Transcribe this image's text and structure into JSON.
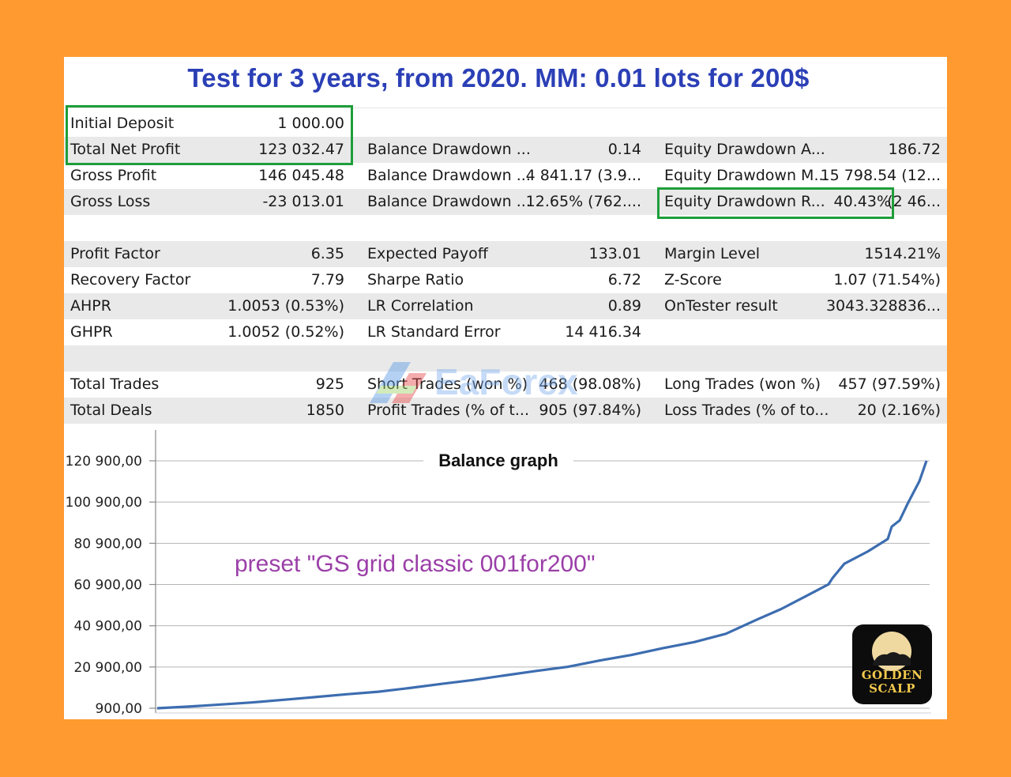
{
  "title": "Test for 3 years, from 2020. MM: 0.01 lots for 200$",
  "stats": {
    "row1": {
      "l1": "Initial Deposit",
      "v1": "1 000.00"
    },
    "row2": {
      "l1": "Total Net Profit",
      "v1": "123 032.47",
      "l2": "Balance Drawdown ...",
      "v2": "0.14",
      "l3": "Equity Drawdown A...",
      "v3": "186.72"
    },
    "row3": {
      "l1": "Gross Profit",
      "v1": "146 045.48",
      "l2": "Balance Drawdown ...",
      "v2": "4 841.17 (3.9...",
      "l3": "Equity Drawdown M...",
      "v3": "15 798.54 (12..."
    },
    "row4": {
      "l1": "Gross Loss",
      "v1": "-23 013.01",
      "l2": "Balance Drawdown ...",
      "v2": "12.65% (762....",
      "l3": "Equity Drawdown R...",
      "v3a": "40.43%",
      "v3b": "(2 46..."
    },
    "row6": {
      "l1": "Profit Factor",
      "v1": "6.35",
      "l2": "Expected Payoff",
      "v2": "133.01",
      "l3": "Margin Level",
      "v3": "1514.21%"
    },
    "row7": {
      "l1": "Recovery Factor",
      "v1": "7.79",
      "l2": "Sharpe Ratio",
      "v2": "6.72",
      "l3": "Z-Score",
      "v3": "1.07 (71.54%)"
    },
    "row8": {
      "l1": "AHPR",
      "v1": "1.0053 (0.53%)",
      "l2": "LR Correlation",
      "v2": "0.89",
      "l3": "OnTester result",
      "v3": "3043.328836..."
    },
    "row9": {
      "l1": "GHPR",
      "v1": "1.0052 (0.52%)",
      "l2": "LR Standard Error",
      "v2": "14 416.34"
    },
    "row11": {
      "l1": "Total Trades",
      "v1": "925",
      "l2": "Short Trades (won %)",
      "v2": "468 (98.08%)",
      "l3": "Long Trades (won %)",
      "v3": "457 (97.59%)"
    },
    "row12": {
      "l1": "Total Deals",
      "v1": "1850",
      "l2": "Profit Trades (% of t...",
      "v2": "905 (97.84%)",
      "l3": "Loss Trades (% of to...",
      "v3": "20 (2.16%)"
    }
  },
  "watermark": "EaForex",
  "chart_data": {
    "type": "line",
    "title": "Balance graph",
    "annotation": "preset \"GS grid classic 001for200\"",
    "ylim": [
      900,
      122400
    ],
    "y_ticks": [
      900,
      20900,
      40900,
      60900,
      80900,
      100900,
      120900
    ],
    "y_tick_labels": [
      "900,00",
      "20 900,00",
      "40 900,00",
      "60 900,00",
      "80 900,00",
      "100 900,00",
      "120 900,00"
    ],
    "line_color": "#3D6DB0",
    "grid": true,
    "series": [
      {
        "x": [
          0,
          40,
          80,
          120,
          160,
          200,
          240,
          280,
          320,
          360,
          400,
          440,
          480,
          520,
          560,
          600,
          640,
          680,
          720,
          760,
          790,
          820,
          850,
          855,
          870,
          900,
          925,
          930,
          940,
          950,
          965,
          974
        ],
        "y": [
          900,
          1700,
          2700,
          3700,
          5000,
          6300,
          7700,
          8900,
          10700,
          12700,
          14600,
          16800,
          19000,
          21000,
          24000,
          26700,
          30000,
          33000,
          37000,
          44000,
          49000,
          55000,
          61000,
          64000,
          71000,
          77000,
          83000,
          89000,
          92000,
          100000,
          111000,
          120900
        ]
      }
    ]
  },
  "logo": {
    "line1": "GOLDEN",
    "line2": "SCALP"
  }
}
